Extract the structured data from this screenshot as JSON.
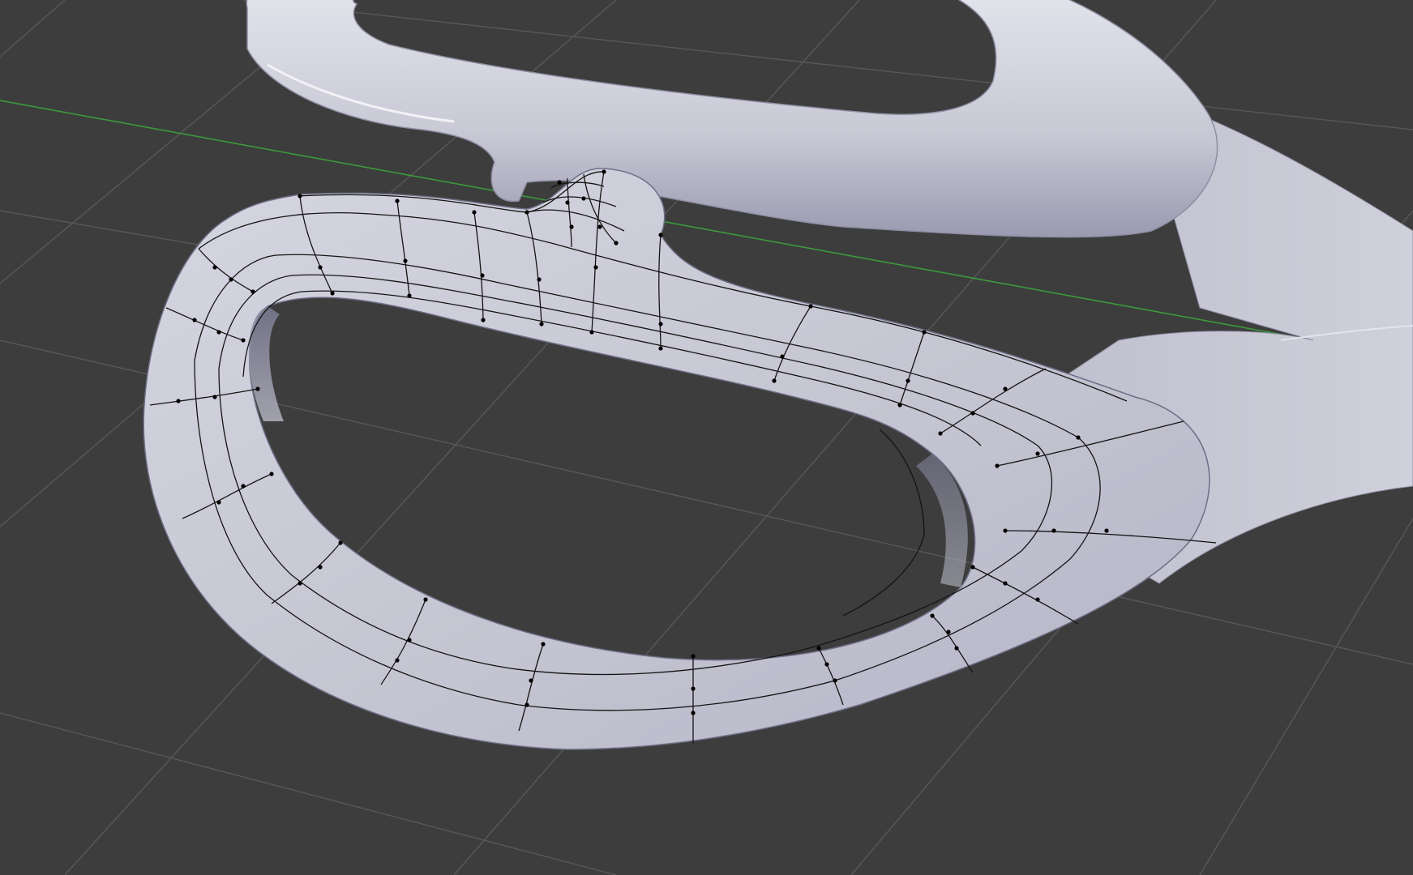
{
  "viewport": {
    "name": "3D Viewport",
    "background_color": "#3d3d3d",
    "grid_color": "#555555",
    "y_axis_color": "#3c9a3c"
  },
  "model": {
    "object": "scissors",
    "surface_color": "#c4c4d2",
    "surface_shadow": "#8e8ea4",
    "wire_color": "#111111",
    "vertex_color": "#000000",
    "mode": "edit-mesh-wireframe-overlay"
  }
}
